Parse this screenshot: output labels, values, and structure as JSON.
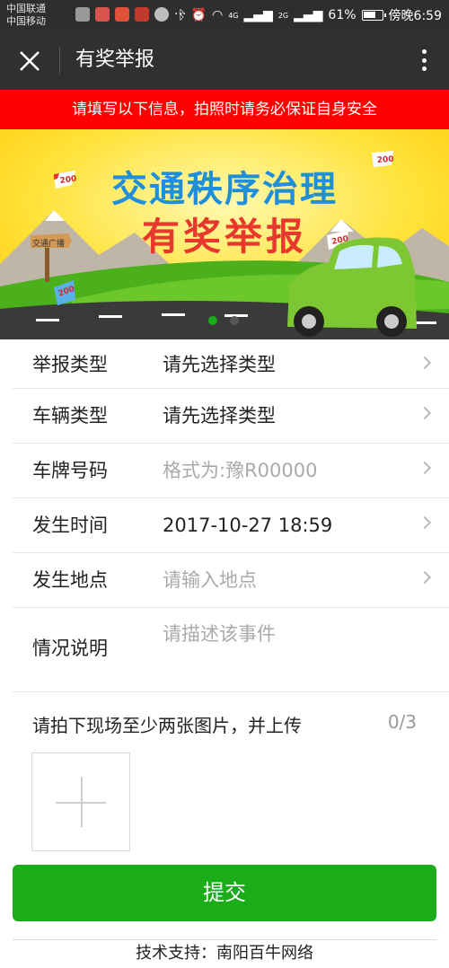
{
  "status_bar": {
    "carrier_1": "中国联通",
    "carrier_2": "中国移动",
    "network": "4G",
    "network_2": "2G",
    "battery": "61%",
    "time": "傍晚6:59"
  },
  "titlebar": {
    "title": "有奖举报"
  },
  "notice": "请填写以下信息，拍照时请务必保证自身安全",
  "banner": {
    "line1": "交通秩序治理",
    "line2": "有奖举报",
    "signpost": "交通广播",
    "flag_number": "200",
    "slides": 2,
    "active_slide": 1
  },
  "form": {
    "rows": [
      {
        "label": "举报类型",
        "value": "请先选择类型",
        "placeholder": false
      },
      {
        "label": "车辆类型",
        "value": "请先选择类型",
        "placeholder": false
      },
      {
        "label": "车牌号码",
        "value": "格式为:豫R00000",
        "placeholder": true
      },
      {
        "label": "发生时间",
        "value": "2017-10-27 18:59",
        "placeholder": false
      },
      {
        "label": "发生地点",
        "value": "请输入地点",
        "placeholder": true
      },
      {
        "label": "情况说明",
        "value": "请描述该事件",
        "placeholder": true
      }
    ]
  },
  "upload": {
    "hint": "请拍下现场至少两张图片，并上传",
    "count": "0/3"
  },
  "submit_label": "提交",
  "footer": "技术支持：南阳百牛网络",
  "colors": {
    "primary_green": "#1aad19",
    "notice_red": "#ff0000",
    "titlebar": "#303030"
  }
}
